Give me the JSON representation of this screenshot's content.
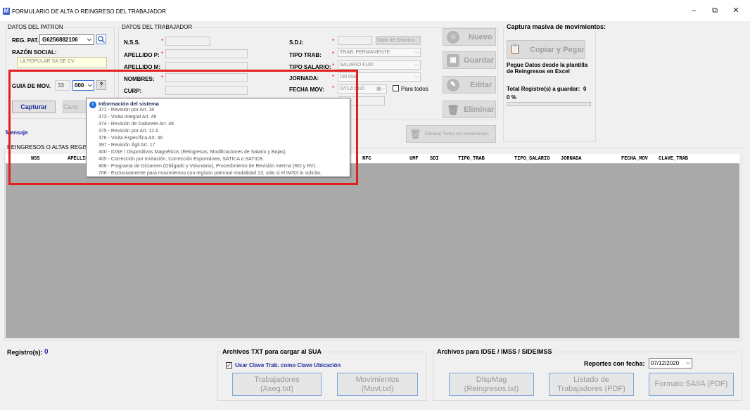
{
  "window": {
    "title": "FORMULARIO DE ALTA O REINGRESO DEL TRABAJADOR",
    "app_icon": "M",
    "minimize": "–",
    "restore": "⧉",
    "close": "✕"
  },
  "patron": {
    "group_title": "DATOS DEL PATRON",
    "reg_pat_label": "REG. PAT.",
    "reg_pat_value": "G6256882106",
    "razon_social_label": "RAZÓN SOCIAL:",
    "razon_social_value": "LA POPULAR SA DE CV",
    "guia_label": "GUIA DE MOV.",
    "guia_prefix": "33",
    "guia_value": "000",
    "help_label": "?",
    "capturar_label": "Capturar",
    "cancelar_label": "Canc"
  },
  "trabajador": {
    "group_title": "DATOS DEL TRABAJADOR",
    "nss_label": "N.S.S.",
    "apellido_p_label": "APELLIDO P:",
    "apellido_m_label": "APELLIDO M:",
    "nombres_label": "NOMBRES:",
    "curp_label": "CURP:",
    "sdi_label": "S.D.I:",
    "tabla_salarios_label": "Tabla de Salarios",
    "tipo_trab_label": "TIPO TRAB:",
    "tipo_trab_value": "TRAB. PERMANENTE",
    "tipo_salario_label": "TIPO SALARIO:",
    "tipo_salario_value": "SALARIO FIJO",
    "jornada_label": "JORNADA:",
    "jornada_value": "UN DIA",
    "fecha_mov_label": "FECHA MOV:",
    "fecha_mov_value": "07/12/2020",
    "para_todos_label": "Para todos"
  },
  "actions": {
    "nuevo": "Nuevo",
    "guardar": "Guardar",
    "editar": "Editar",
    "eliminar": "Eliminar",
    "eliminar_todos": "Eliminar Todos los movimientos"
  },
  "captura_masiva": {
    "title": "Captura masiva de movimientos:",
    "copiar_pegar": "Copiar y Pegar",
    "hint": "Pegue Datos desde la plantilla de Reingresos en Excel",
    "total_label": "Total Registro(s) a guardar:",
    "total_value": "0",
    "percent": "0 %",
    "progress": 0
  },
  "mensaje_label": "Mensaje",
  "grid": {
    "caption": "REINGRESOS O ALTAS REGISTRADOS",
    "columns": [
      "NSS",
      "APELLIDO",
      "RFC",
      "UMF",
      "SDI",
      "TIPO_TRAB",
      "TIPO_SALARIO",
      "JORNADA",
      "FECHA_MOV",
      "CLAVE_TRAB"
    ]
  },
  "tooltip": {
    "title": "Información del sistema",
    "icon": "i",
    "lines": [
      "371 - Revisión por Art. 18",
      "373 - Visita Integral Art. 46",
      "374 - Revisión de Gabinete Art. 48",
      "375 - Revisión por Art. 12 A",
      "376 - Visita Específica Art. 46",
      "397 - Revisión Ágil Art. 17",
      "400 - IDSE / Dispositivos Magnéticos (Reingresos, Modificaciones de Salario y Bajas)",
      "405 - Corrección por Invitación, Corrección Espontánea, SATICA o SATICB.",
      "406 - Programa de Dictamen (Obligado y Voluntario), Procedimiento de Revisión Interna (RO y RV).",
      "706 - Exclusivamente para movimientos con registro patronal modalidad 13, sólo si el IMSS lo solicita."
    ]
  },
  "footer": {
    "registros_label": "Registro(s):",
    "registros_value": "0",
    "txt_group_title": "Archivos  TXT para cargar al SUA",
    "usar_clave_label": "Usar Clave Trab. como Clave Ubicación",
    "usar_clave_checked": true,
    "trabajadores_btn": "Trabajadores\n(Aseg.txt)",
    "movimientos_btn": "Movimientos\n(Movt.txt)",
    "idse_group_title": "Archivos para IDSE / IMSS / SIDEIMSS",
    "reportes_label": "Reportes con fecha:",
    "reportes_date": "07/12/2020",
    "dispmag_btn": "DispMag\n(Reingresos.txt)",
    "listado_btn": "Listado de\nTrabajadores (PDF)",
    "formato_btn": "Formato SAIIA (PDF)"
  }
}
